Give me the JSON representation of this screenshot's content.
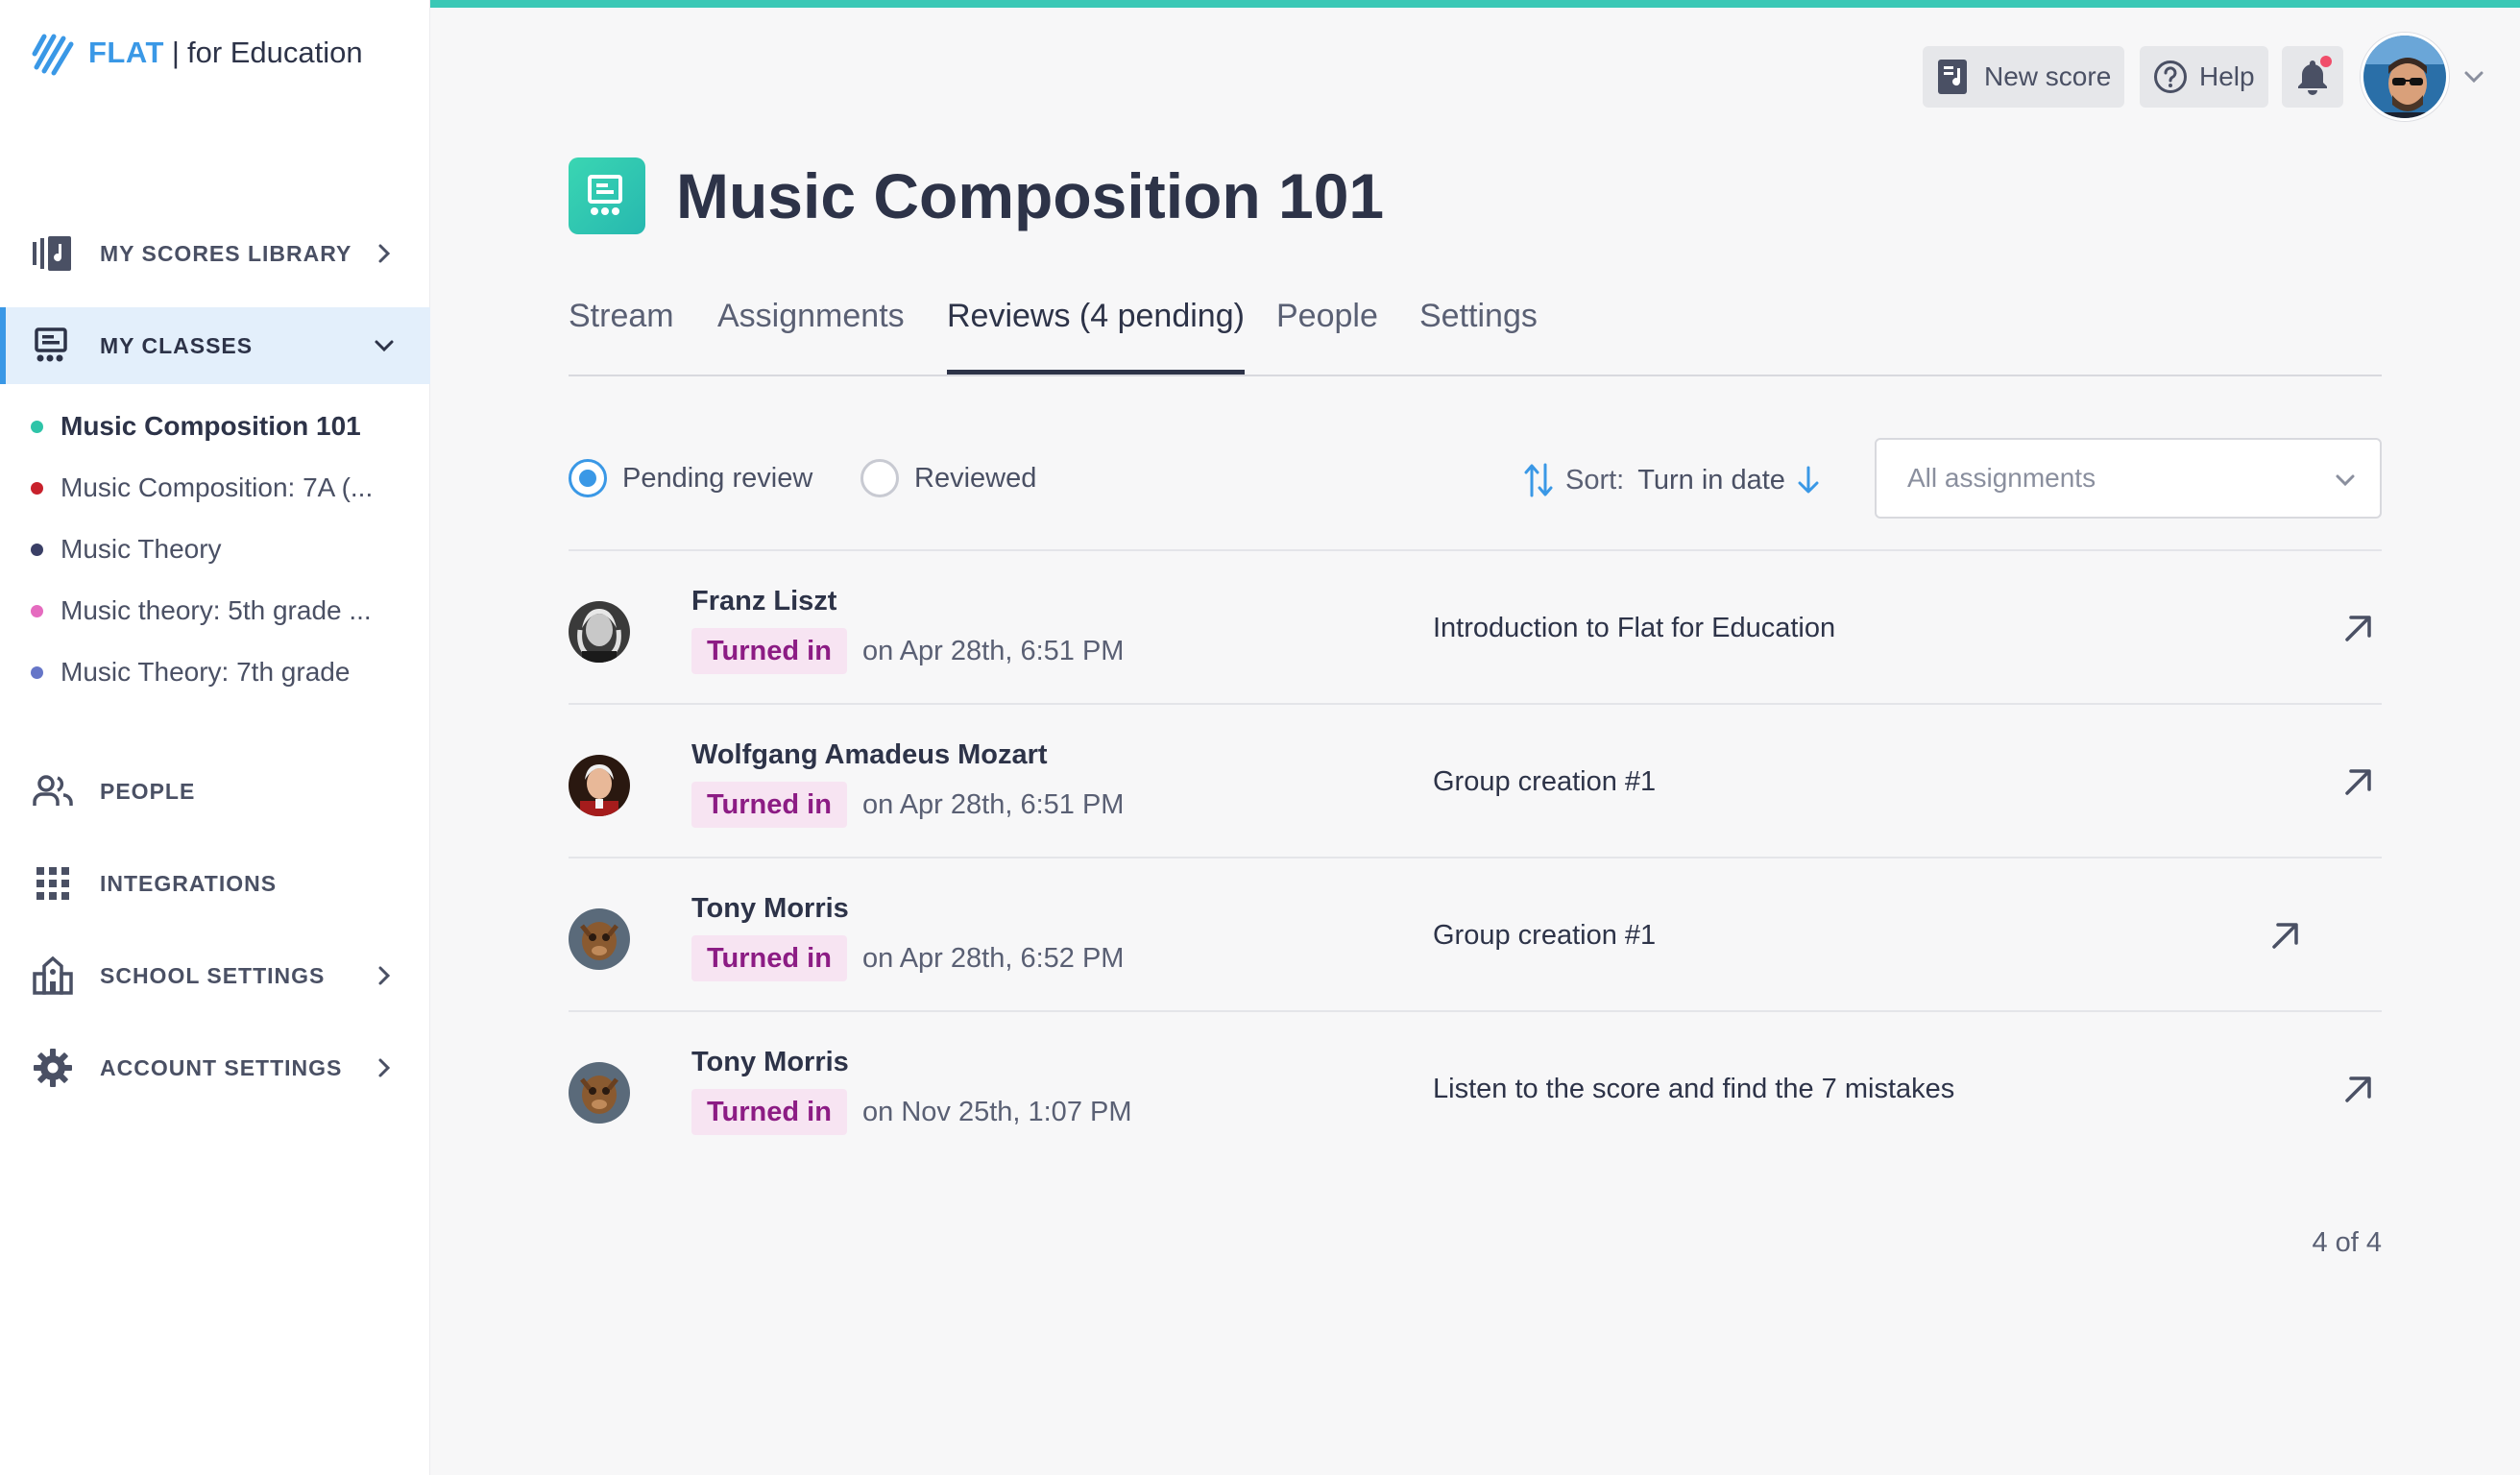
{
  "brand": {
    "name": "FLAT",
    "separator": "|",
    "suffix": "for Education"
  },
  "nav": {
    "library": "MY SCORES LIBRARY",
    "classes": "MY CLASSES",
    "people": "PEOPLE",
    "integrations": "INTEGRATIONS",
    "school_settings": "SCHOOL SETTINGS",
    "account_settings": "ACCOUNT SETTINGS"
  },
  "classes": [
    {
      "name": "Music Composition 101",
      "color": "#2ec4a8"
    },
    {
      "name": "Music Composition: 7A  (...",
      "color": "#c8212c"
    },
    {
      "name": "Music Theory",
      "color": "#3a3f66"
    },
    {
      "name": "Music theory: 5th grade  ...",
      "color": "#e56bbf"
    },
    {
      "name": "Music Theory: 7th grade",
      "color": "#6676c8"
    }
  ],
  "header": {
    "new_score": "New score",
    "help": "Help"
  },
  "page": {
    "title": "Music Composition 101"
  },
  "tabs": [
    "Stream",
    "Assignments",
    "Reviews (4 pending)",
    "People",
    "Settings"
  ],
  "filters": {
    "pending": "Pending review",
    "reviewed": "Reviewed",
    "sort_label": "Sort:",
    "sort_value": "Turn in date",
    "assignments_placeholder": "All assignments"
  },
  "reviews": [
    {
      "student": "Franz Liszt",
      "status": "Turned in",
      "date": "on Apr 28th, 6:51 PM",
      "assignment": "Introduction to Flat for Education"
    },
    {
      "student": "Wolfgang Amadeus Mozart",
      "status": "Turned in",
      "date": "on Apr 28th, 6:51 PM",
      "assignment": "Group creation #1"
    },
    {
      "student": "Tony Morris",
      "status": "Turned in",
      "date": "on Apr 28th, 6:52 PM",
      "assignment": "Group creation #1"
    },
    {
      "student": "Tony Morris",
      "status": "Turned in",
      "date": "on Nov 25th, 1:07 PM",
      "assignment": "Listen to the score and find the 7 mistakes"
    }
  ],
  "pager": "4 of 4",
  "colors": {
    "accent": "#3a98e6",
    "teal": "#3ac8b6",
    "badge_bg": "#f7e4f2",
    "badge_text": "#8c1c84"
  }
}
